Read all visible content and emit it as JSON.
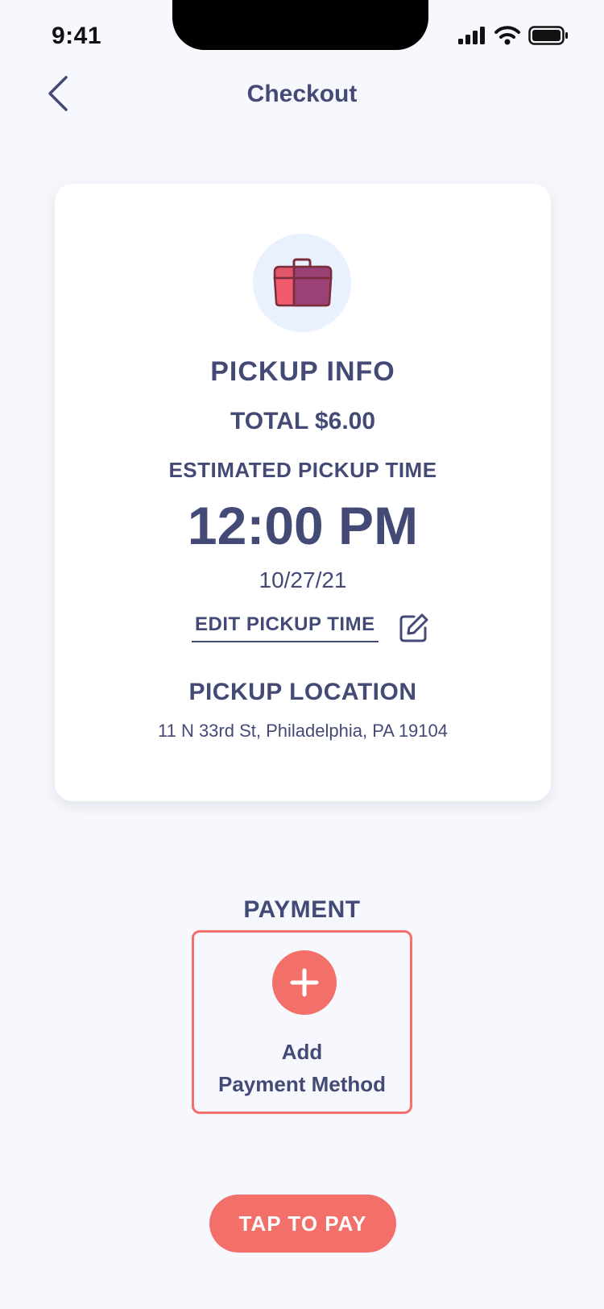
{
  "status_bar": {
    "time": "9:41"
  },
  "nav": {
    "title": "Checkout"
  },
  "pickup": {
    "heading": "PICKUP INFO",
    "total": "TOTAL $6.00",
    "estimated_label": "ESTIMATED PICKUP TIME",
    "time": "12:00 PM",
    "date": "10/27/21",
    "edit_label": "EDIT PICKUP TIME",
    "location_label": "PICKUP LOCATION",
    "address": "11 N 33rd St, Philadelphia, PA 19104"
  },
  "payment": {
    "heading": "PAYMENT",
    "add_line1": "Add",
    "add_line2": "Payment Method"
  },
  "pay_button": {
    "label": "TAP TO PAY"
  },
  "colors": {
    "background": "#f7f8fd",
    "text": "#444a76",
    "accent": "#f36f6a",
    "icon_circle": "#e8f1fd",
    "card": "#ffffff"
  },
  "icons": {
    "back": "chevron-left-icon",
    "lunchbox": "lunchbox-icon",
    "edit": "edit-pencil-icon",
    "plus": "plus-icon",
    "signal": "signal-icon",
    "wifi": "wifi-icon",
    "battery": "battery-icon"
  }
}
